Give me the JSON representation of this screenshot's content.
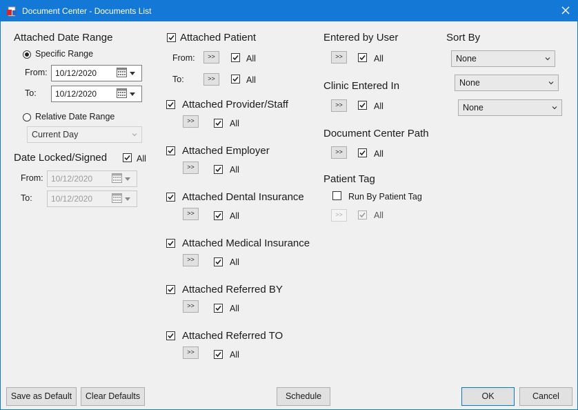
{
  "window": {
    "title": "Document Center - Documents List"
  },
  "date_range": {
    "header": "Attached Date Range",
    "specific_label": "Specific Range",
    "from_label": "From:",
    "from_value": "10/12/2020",
    "to_label": "To:",
    "to_value": "10/12/2020",
    "relative_label": "Relative Date Range",
    "relative_select": "Current Day"
  },
  "date_locked": {
    "header": "Date Locked/Signed",
    "all_label": "All",
    "from_label": "From:",
    "from_value": "10/12/2020",
    "to_label": "To:",
    "to_value": "10/12/2020"
  },
  "attached_patient": {
    "label": "Attached Patient",
    "from_label": "From:",
    "to_label": "To:",
    "arrow": ">>",
    "all_label": "All"
  },
  "attached_groups": [
    {
      "label": "Attached Provider/Staff",
      "arrow": ">>",
      "all_label": "All"
    },
    {
      "label": "Attached Employer",
      "arrow": ">>",
      "all_label": "All"
    },
    {
      "label": "Attached Dental Insurance",
      "arrow": ">>",
      "all_label": "All"
    },
    {
      "label": "Attached Medical Insurance",
      "arrow": ">>",
      "all_label": "All"
    },
    {
      "label": "Attached Referred BY",
      "arrow": ">>",
      "all_label": "All"
    },
    {
      "label": "Attached Referred TO",
      "arrow": ">>",
      "all_label": "All"
    }
  ],
  "entered_by_user": {
    "header": "Entered by User",
    "arrow": ">>",
    "all_label": "All"
  },
  "clinic_entered_in": {
    "header": "Clinic Entered In",
    "arrow": ">>",
    "all_label": "All"
  },
  "doc_center_path": {
    "header": "Document Center Path",
    "arrow": ">>",
    "all_label": "All"
  },
  "patient_tag": {
    "header": "Patient Tag",
    "run_label": "Run By Patient Tag",
    "arrow": ">>",
    "all_label": "All"
  },
  "sort_by": {
    "header": "Sort By",
    "options": [
      "None",
      "None",
      "None"
    ]
  },
  "buttons": {
    "save_default": "Save as Default",
    "clear_defaults": "Clear Defaults",
    "schedule": "Schedule",
    "ok": "OK",
    "cancel": "Cancel"
  },
  "colors": {
    "titlebar": "#1479d6",
    "accent": "#0078d7",
    "background": "#f0f0f0"
  }
}
